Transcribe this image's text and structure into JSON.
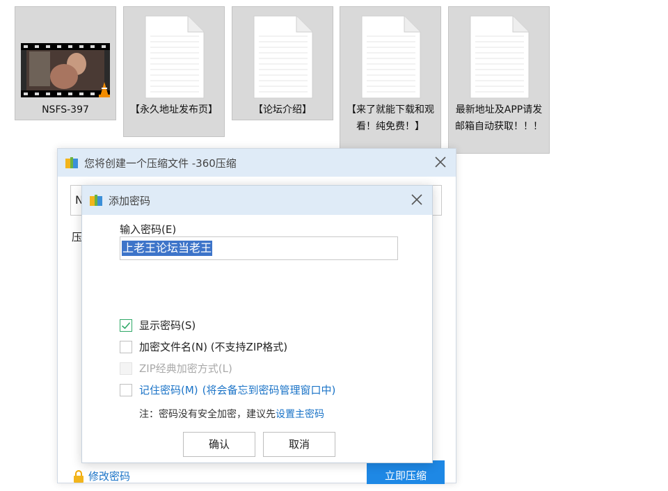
{
  "files": [
    {
      "name": "NSFS-397",
      "type": "video"
    },
    {
      "name": "【永久地址发布页】",
      "type": "document"
    },
    {
      "name": "【论坛介绍】",
      "type": "document"
    },
    {
      "name": "【来了就能下载和观看！纯免费！】",
      "type": "document"
    },
    {
      "name": "最新地址及APP请发邮箱自动获取！！！",
      "type": "document"
    }
  ],
  "compress_dialog": {
    "title": "您将创建一个压缩文件 -360压缩",
    "path_prefix": "N",
    "side_label": "压",
    "modify_password": "修改密码",
    "compress_now": "立即压缩"
  },
  "password_dialog": {
    "title": "添加密码",
    "input_label": "输入密码(E)",
    "password_value": "上老王论坛当老王",
    "options": {
      "show_password": {
        "label": "显示密码(S)",
        "checked": true
      },
      "encrypt_filenames": {
        "label": "加密文件名(N) (不支持ZIP格式)",
        "checked": false
      },
      "zip_classic": {
        "label": "ZIP经典加密方式(L)",
        "checked": false,
        "disabled": true
      },
      "remember_password": {
        "label": "记住密码(M)",
        "note": "(将会备忘到密码管理窗口中)",
        "checked": false
      }
    },
    "note_text": "注：密码没有安全加密，建议先",
    "note_link": "设置主密码",
    "ok": "确认",
    "cancel": "取消"
  },
  "colors": {
    "accent": "#1e88e5",
    "link": "#1a73c7",
    "titlebar": "#dfebf7",
    "check": "#2ea866",
    "selection": "#3d74c9"
  },
  "icons": {
    "close": "close-icon",
    "app": "360zip-app-icon",
    "lock": "lock-icon",
    "document": "document-icon",
    "vlc": "vlc-cone-icon"
  }
}
